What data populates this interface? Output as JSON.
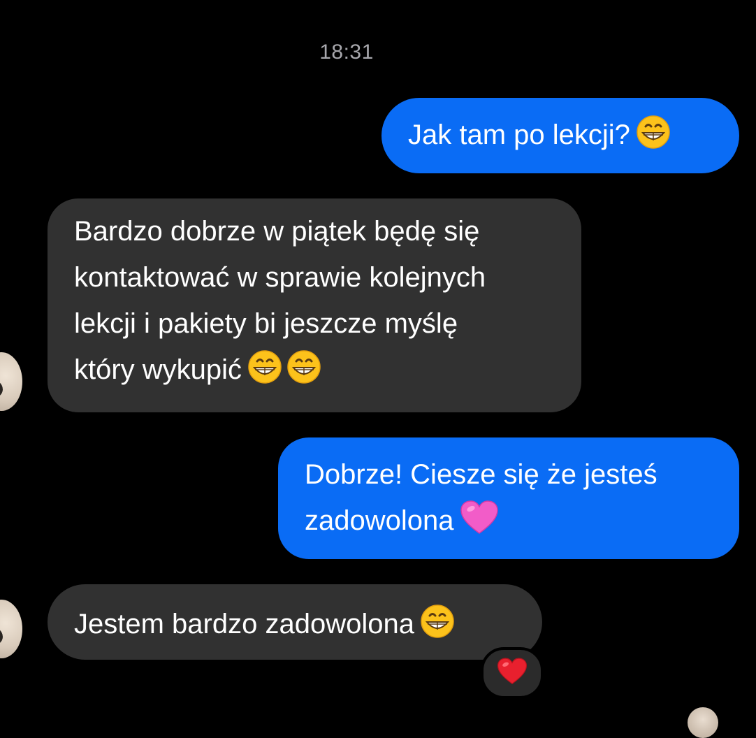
{
  "chat": {
    "timestamp": "18:31",
    "messages": [
      {
        "direction": "outgoing",
        "lines": [
          "Jak tam po lekcji?"
        ],
        "emoji": [
          "grinning-face-with-smiling-eyes"
        ]
      },
      {
        "direction": "incoming",
        "lines": [
          "Bardzo dobrze w piątek będę się",
          "kontaktować w sprawie kolejnych",
          "lekcji i pakiety bi jeszcze myślę",
          "który wykupić"
        ],
        "emoji": [
          "grinning-face-with-smiling-eyes",
          "grinning-face-with-smiling-eyes"
        ]
      },
      {
        "direction": "outgoing",
        "lines": [
          "Dobrze! Ciesze się że jesteś",
          "zadowolona"
        ],
        "emoji": [
          "pink-heart"
        ]
      },
      {
        "direction": "incoming",
        "lines": [
          "Jestem bardzo zadowolona"
        ],
        "emoji": [
          "grinning-face-with-smiling-eyes"
        ],
        "reaction": "red-heart"
      }
    ]
  },
  "colors": {
    "background": "#000000",
    "outgoing_bubble": "#0a6cf5",
    "incoming_bubble": "#313131",
    "timestamp_text": "#a8a8ad"
  }
}
